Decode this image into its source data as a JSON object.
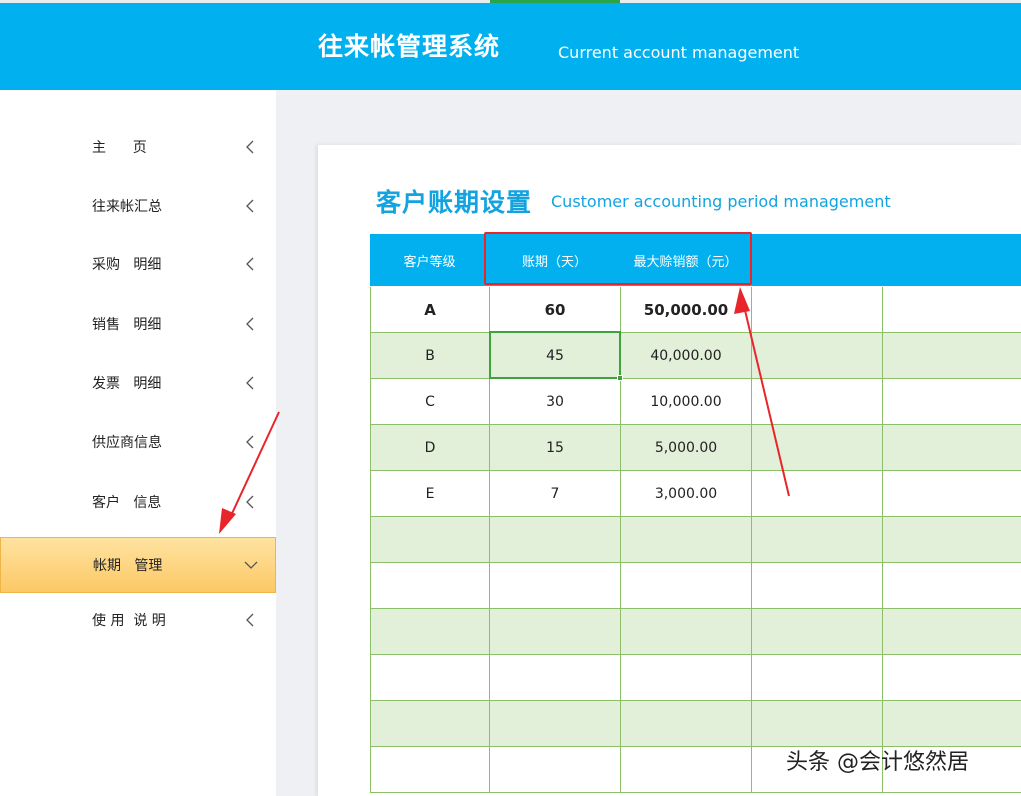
{
  "header": {
    "title": "往来帐管理系统",
    "subtitle": "Current account management"
  },
  "sidebar": {
    "items": [
      {
        "label": "主      页",
        "active": false
      },
      {
        "label": "往来帐汇总",
        "active": false
      },
      {
        "label": "采购   明细",
        "active": false
      },
      {
        "label": "销售   明细",
        "active": false
      },
      {
        "label": "发票   明细",
        "active": false
      },
      {
        "label": "供应商信息",
        "active": false
      },
      {
        "label": "客户   信息",
        "active": false
      },
      {
        "label": "帐期   管理",
        "active": true
      },
      {
        "label": "使 用  说 明",
        "active": false
      }
    ]
  },
  "main": {
    "title": "客户账期设置",
    "subtitle": "Customer accounting period management"
  },
  "table": {
    "headers": [
      "客户等级",
      "账期（天）",
      "最大赊销额（元）",
      "",
      ""
    ],
    "rows": [
      [
        "A",
        "60",
        "50,000.00",
        "",
        ""
      ],
      [
        "B",
        "45",
        "40,000.00",
        "",
        ""
      ],
      [
        "C",
        "30",
        "10,000.00",
        "",
        ""
      ],
      [
        "D",
        "15",
        "5,000.00",
        "",
        ""
      ],
      [
        "E",
        "7",
        "3,000.00",
        "",
        ""
      ],
      [
        "",
        "",
        "",
        "",
        ""
      ],
      [
        "",
        "",
        "",
        "",
        ""
      ],
      [
        "",
        "",
        "",
        "",
        ""
      ],
      [
        "",
        "",
        "",
        "",
        ""
      ],
      [
        "",
        "",
        "",
        "",
        ""
      ],
      [
        "",
        "",
        "",
        "",
        ""
      ]
    ]
  },
  "watermark": "头条 @会计悠然居",
  "colors": {
    "header_bg": "#01b0ef",
    "table_header_bg": "#02b0ef",
    "row_green": "#e2efd9",
    "active_nav": "#fcc865",
    "annotation_red": "#e8252a",
    "selection_green": "#3ea33e"
  }
}
